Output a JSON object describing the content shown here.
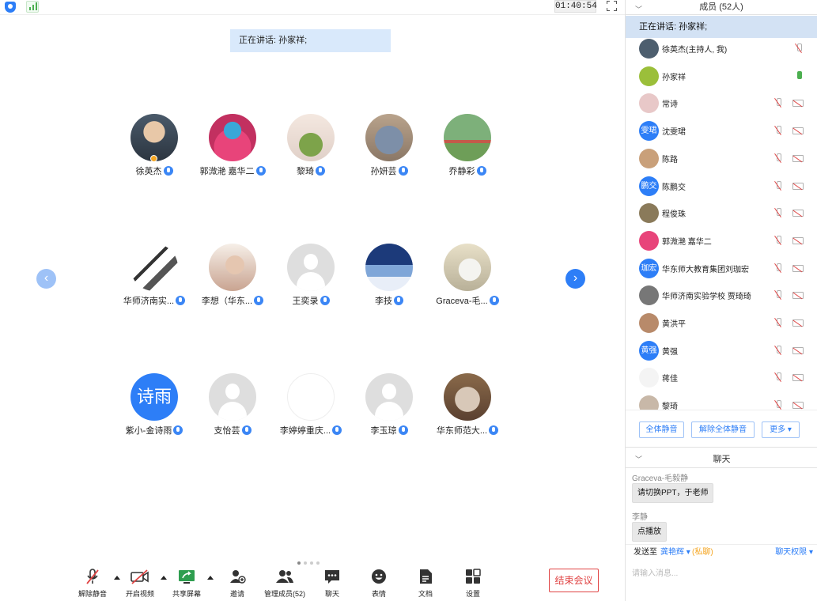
{
  "topbar": {
    "timer": "01:40:54"
  },
  "gallery": {
    "speaker_banner": "正在讲话: 孙家祥;",
    "tiles": [
      {
        "name": "徐英杰",
        "avatar": "photo-person-glasses",
        "host": true
      },
      {
        "name": "郭溦滟 嘉华二",
        "avatar": "troll-doll"
      },
      {
        "name": "黎琦",
        "avatar": "cartoon-plants"
      },
      {
        "name": "孙妍芸",
        "avatar": "cartoon-cat-tom"
      },
      {
        "name": "乔静彩",
        "avatar": "photo-field"
      },
      {
        "name": "华师济南实...",
        "avatar": "sketch-building"
      },
      {
        "name": "李想（华东...",
        "avatar": "photo-woman"
      },
      {
        "name": "王奕录",
        "avatar": "placeholder"
      },
      {
        "name": "李技",
        "avatar": "photo-clouds"
      },
      {
        "name": "Graceva-毛...",
        "avatar": "drawing-mouse"
      },
      {
        "name": "紫小-金诗雨",
        "avatar": "text",
        "avatar_text": "诗雨"
      },
      {
        "name": "支怡芸",
        "avatar": "placeholder"
      },
      {
        "name": "李婷婷重庆...",
        "avatar": "sketch-girl"
      },
      {
        "name": "李玉琼",
        "avatar": "placeholder"
      },
      {
        "name": "华东师范大...",
        "avatar": "photo-cat"
      }
    ]
  },
  "toolbar": {
    "unmute": "解除静音",
    "start_video": "开启视频",
    "share_screen": "共享屏幕",
    "invite": "邀请",
    "manage_members": "管理成员(52)",
    "chat": "聊天",
    "reactions": "表情",
    "docs": "文档",
    "settings": "设置",
    "end_meeting": "结束会议"
  },
  "panel": {
    "members_title": "成员 (52人)",
    "speaking": "正在讲话: 孙家祥;",
    "members": [
      {
        "name": "徐英杰(主持人, 我)",
        "avatar": "photo",
        "mic": "off",
        "cam": false
      },
      {
        "name": "孙家祥",
        "avatar": "photo",
        "mic": "on",
        "cam": false
      },
      {
        "name": "常诗",
        "avatar": "photo",
        "mic": "off",
        "cam": true
      },
      {
        "name": "沈雯珺",
        "avatar": "text",
        "avatar_text": "雯珺",
        "mic": "off",
        "cam": true
      },
      {
        "name": "陈路",
        "avatar": "photo",
        "mic": "off",
        "cam": true
      },
      {
        "name": "陈鹏交",
        "avatar": "text",
        "avatar_text": "鹏交",
        "mic": "off",
        "cam": true
      },
      {
        "name": "程俊珠",
        "avatar": "photo",
        "mic": "off",
        "cam": true
      },
      {
        "name": "郭溦滟 嘉华二",
        "avatar": "photo",
        "mic": "off",
        "cam": true
      },
      {
        "name": "华东师大教育集团刘珈宏",
        "avatar": "text",
        "avatar_text": "珈宏",
        "mic": "off",
        "cam": true
      },
      {
        "name": "华师济南实验学校 贾琦琦",
        "avatar": "photo",
        "mic": "off",
        "cam": true
      },
      {
        "name": "黄洪平",
        "avatar": "photo",
        "mic": "off",
        "cam": true
      },
      {
        "name": "黄强",
        "avatar": "text",
        "avatar_text": "黄强",
        "mic": "off",
        "cam": true
      },
      {
        "name": "蒋佳",
        "avatar": "photo",
        "mic": "off",
        "cam": true
      },
      {
        "name": "黎琦",
        "avatar": "photo",
        "mic": "off",
        "cam": true
      }
    ],
    "mute_all": "全体静音",
    "unmute_all": "解除全体静音",
    "more": "更多 ▾",
    "chat_title": "聊天",
    "messages": [
      {
        "sender": "Graceva-毛毅静",
        "text": "请切换PPT，于老师"
      },
      {
        "sender": "李静",
        "text": "点播放"
      }
    ],
    "send_to_label": "发送至",
    "send_to_target": "龚艳辉 ▾",
    "private_tag": "(私聊)",
    "chat_permissions": "聊天权限 ▾",
    "chat_placeholder": "请输入消息..."
  },
  "colors": {
    "accent": "#2d7ef7",
    "end": "#e04343",
    "speaker_bg": "#d9e9fb"
  }
}
